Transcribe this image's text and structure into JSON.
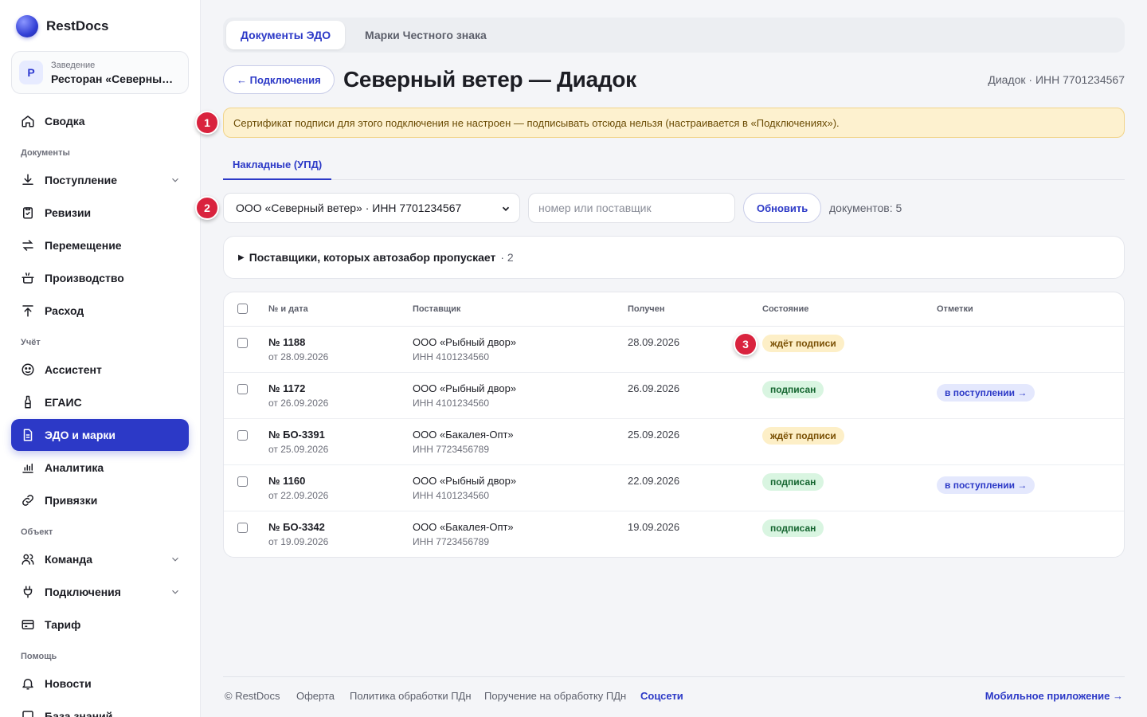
{
  "brand": {
    "name": "RestDocs"
  },
  "venue": {
    "avatar": "Р",
    "caption": "Заведение",
    "name": "Ресторан «Северный ветер»"
  },
  "nav": {
    "summary": "Сводка",
    "section_documents": "Документы",
    "receipt": "Поступление",
    "audits": "Ревизии",
    "transfer": "Перемещение",
    "production": "Производство",
    "expense": "Расход",
    "section_accounting": "Учёт",
    "assistant": "Ассистент",
    "egais": "ЕГАИС",
    "edo": "ЭДО и марки",
    "analytics": "Аналитика",
    "bindings": "Привязки",
    "section_object": "Объект",
    "team": "Команда",
    "connections": "Подключения",
    "tariff": "Тариф",
    "section_help": "Помощь",
    "news": "Новости",
    "kb": "База знаний"
  },
  "tabs": {
    "edo": "Документы ЭДО",
    "marks": "Марки Честного знака"
  },
  "header": {
    "back": "← Подключения",
    "title": "Северный ветер — Диадок",
    "meta": "Диадок · ИНН 7701234567"
  },
  "alert": {
    "text": "Сертификат подписи для этого подключения не настроен — подписывать отсюда нельзя (настраивается в «Подключениях»)."
  },
  "markers": {
    "m1": "1",
    "m2": "2",
    "m3": "3"
  },
  "subtabs": {
    "invoices": "Накладные (УПД)"
  },
  "filters": {
    "org": "ООО «Северный ветер» · ИНН 7701234567",
    "search_placeholder": "номер или поставщик",
    "search_value": "",
    "refresh": "Обновить",
    "count_label": "документов:",
    "count": "5"
  },
  "skipped": {
    "label": "Поставщики, которых автозабор пропускает",
    "count": "· 2"
  },
  "table": {
    "headers": {
      "num": "№ и дата",
      "supplier": "Поставщик",
      "received": "Получен",
      "state": "Состояние",
      "marks": "Отметки"
    },
    "rows": [
      {
        "num": "№ 1188",
        "date": "от 28.09.2026",
        "supplier": "ООО «Рыбный двор»",
        "inn": "ИНН 4101234560",
        "received": "28.09.2026",
        "state": "ждёт подписи",
        "mark": ""
      },
      {
        "num": "№ 1172",
        "date": "от 26.09.2026",
        "supplier": "ООО «Рыбный двор»",
        "inn": "ИНН 4101234560",
        "received": "26.09.2026",
        "state": "подписан",
        "mark": "в поступлении →"
      },
      {
        "num": "№ БО-3391",
        "date": "от 25.09.2026",
        "supplier": "ООО «Бакалея-Опт»",
        "inn": "ИНН 7723456789",
        "received": "25.09.2026",
        "state": "ждёт подписи",
        "mark": ""
      },
      {
        "num": "№ 1160",
        "date": "от 22.09.2026",
        "supplier": "ООО «Рыбный двор»",
        "inn": "ИНН 4101234560",
        "received": "22.09.2026",
        "state": "подписан",
        "mark": "в поступлении →"
      },
      {
        "num": "№ БО-3342",
        "date": "от 19.09.2026",
        "supplier": "ООО «Бакалея-Опт»",
        "inn": "ИНН 7723456789",
        "received": "19.09.2026",
        "state": "подписан",
        "mark": ""
      }
    ]
  },
  "footer": {
    "copy": "© RestDocs",
    "offer": "Оферта",
    "policy": "Политика обработки ПДн",
    "order": "Поручение на обработку ПДн",
    "social": "Соцсети",
    "mobile": "Мобильное приложение →"
  },
  "colors": {
    "accent": "#2c39c7",
    "warning_bg": "#fdf1cf",
    "marker": "#d9233e",
    "ok": "#14652f",
    "wait": "#7a5004"
  }
}
